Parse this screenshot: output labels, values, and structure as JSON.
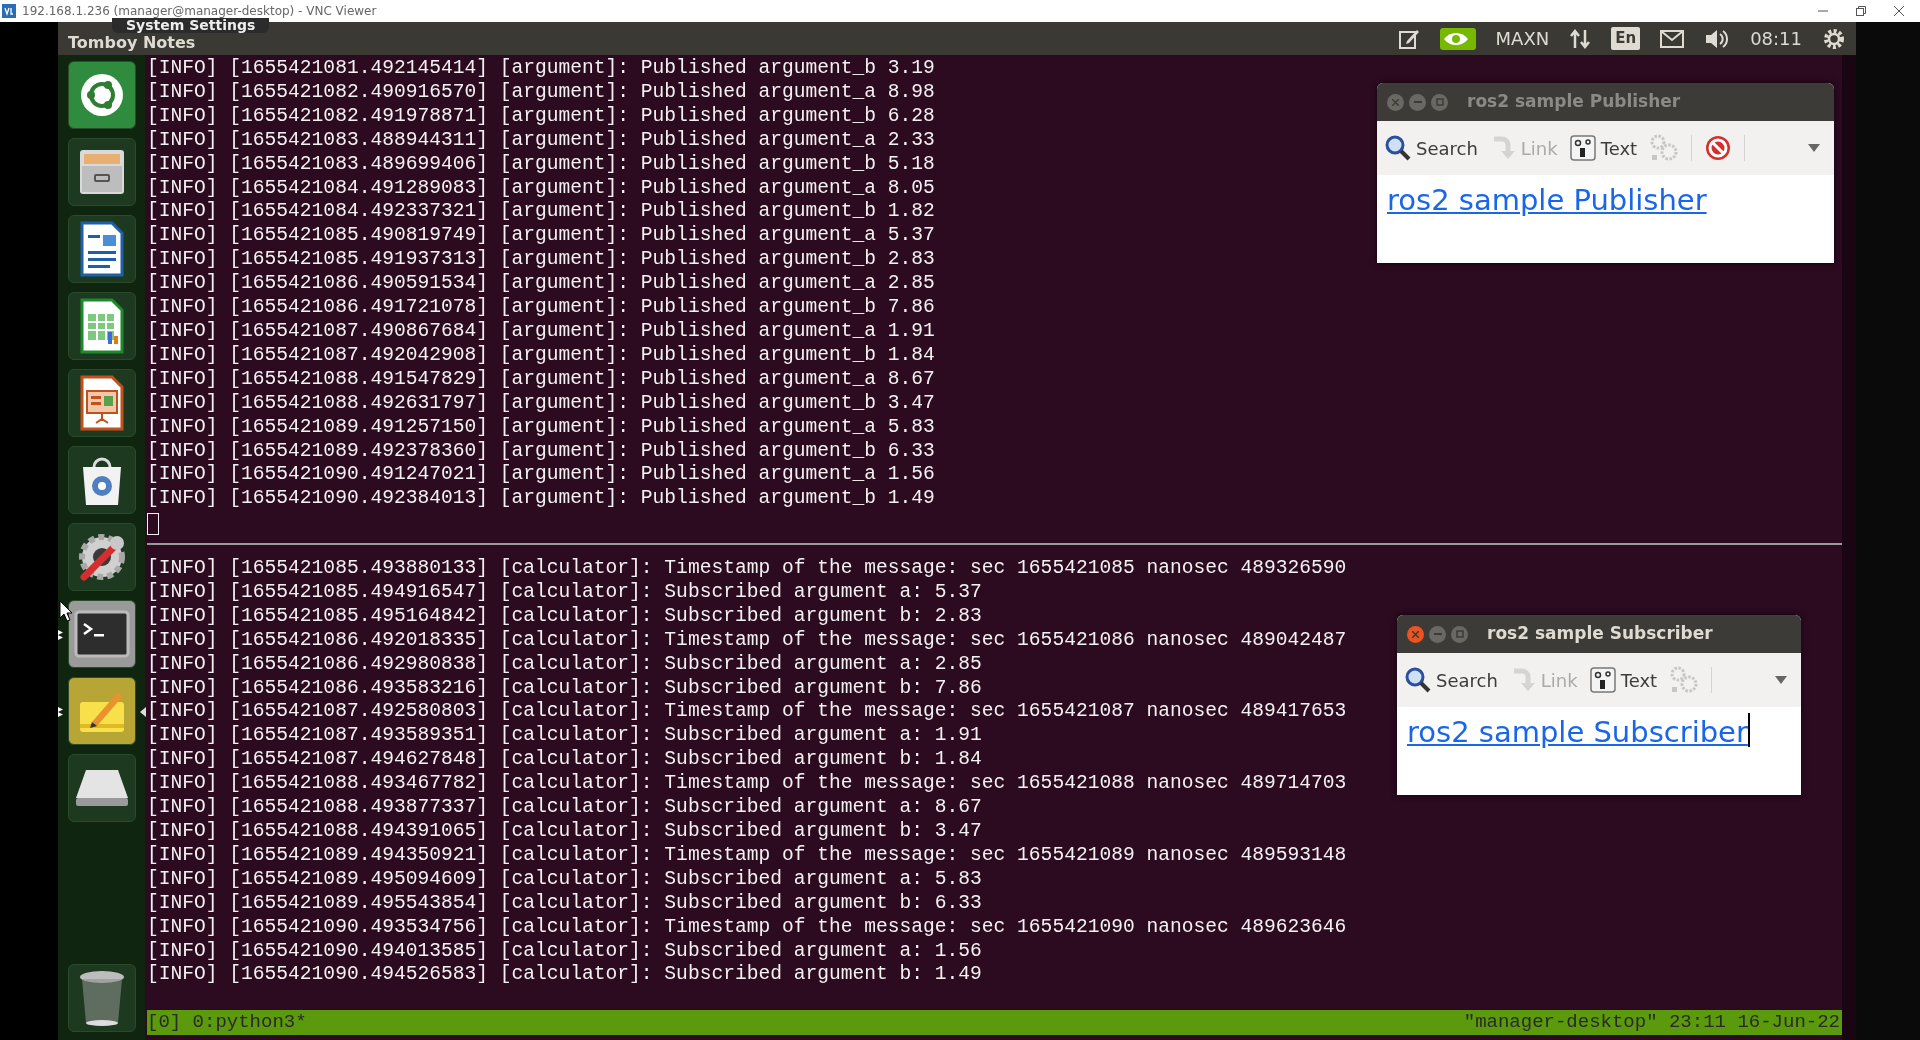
{
  "vnc_window": {
    "title": "192.168.1.236 (manager@manager-desktop) - VNC Viewer"
  },
  "top_panel": {
    "app_title": "Tomboy Notes",
    "tooltip": "System Settings",
    "indicators": [
      {
        "kind": "edit"
      },
      {
        "kind": "nvidia"
      },
      {
        "kind": "text",
        "label": "MAXN"
      },
      {
        "kind": "network"
      },
      {
        "kind": "keyboard",
        "label": "En"
      },
      {
        "kind": "mail"
      },
      {
        "kind": "volume"
      },
      {
        "kind": "text",
        "label": "08:11"
      },
      {
        "kind": "gear"
      }
    ]
  },
  "launcher": {
    "items": [
      {
        "kind": "dash",
        "running": false,
        "focused": false
      },
      {
        "kind": "files",
        "running": false,
        "focused": false
      },
      {
        "kind": "writer",
        "running": false,
        "focused": false
      },
      {
        "kind": "calc",
        "running": false,
        "focused": false
      },
      {
        "kind": "impress",
        "running": false,
        "focused": false
      },
      {
        "kind": "software",
        "running": false,
        "focused": false
      },
      {
        "kind": "settings",
        "running": false,
        "focused": false
      },
      {
        "kind": "terminal",
        "running": true,
        "focused": false
      },
      {
        "kind": "notes",
        "running": true,
        "focused": true
      },
      {
        "kind": "drive",
        "running": false,
        "focused": false
      }
    ],
    "trash": {
      "kind": "trash"
    }
  },
  "terminal": {
    "top_pane": {
      "lines": [
        "[INFO] [1655421081.492145414] [argument]: Published argument_b 3.19",
        "[INFO] [1655421082.490916570] [argument]: Published argument_a 8.98",
        "[INFO] [1655421082.491978871] [argument]: Published argument_b 6.28",
        "[INFO] [1655421083.488944311] [argument]: Published argument_a 2.33",
        "[INFO] [1655421083.489699406] [argument]: Published argument_b 5.18",
        "[INFO] [1655421084.491289083] [argument]: Published argument_a 8.05",
        "[INFO] [1655421084.492337321] [argument]: Published argument_b 1.82",
        "[INFO] [1655421085.490819749] [argument]: Published argument_a 5.37",
        "[INFO] [1655421085.491937313] [argument]: Published argument_b 2.83",
        "[INFO] [1655421086.490591534] [argument]: Published argument_a 2.85",
        "[INFO] [1655421086.491721078] [argument]: Published argument_b 7.86",
        "[INFO] [1655421087.490867684] [argument]: Published argument_a 1.91",
        "[INFO] [1655421087.492042908] [argument]: Published argument_b 1.84",
        "[INFO] [1655421088.491547829] [argument]: Published argument_a 8.67",
        "[INFO] [1655421088.492631797] [argument]: Published argument_b 3.47",
        "[INFO] [1655421089.491257150] [argument]: Published argument_a 5.83",
        "[INFO] [1655421089.492378360] [argument]: Published argument_b 6.33",
        "[INFO] [1655421090.491247021] [argument]: Published argument_a 1.56",
        "[INFO] [1655421090.492384013] [argument]: Published argument_b 1.49"
      ],
      "cursor": true
    },
    "bottom_pane": {
      "lines": [
        "[INFO] [1655421085.493880133] [calculator]: Timestamp of the message: sec 1655421085 nanosec 489326590",
        "[INFO] [1655421085.494916547] [calculator]: Subscribed argument a: 5.37",
        "[INFO] [1655421085.495164842] [calculator]: Subscribed argument b: 2.83",
        "[INFO] [1655421086.492018335] [calculator]: Timestamp of the message: sec 1655421086 nanosec 489042487",
        "[INFO] [1655421086.492980838] [calculator]: Subscribed argument a: 2.85",
        "[INFO] [1655421086.493583216] [calculator]: Subscribed argument b: 7.86",
        "[INFO] [1655421087.492580803] [calculator]: Timestamp of the message: sec 1655421087 nanosec 489417653",
        "[INFO] [1655421087.493589351] [calculator]: Subscribed argument a: 1.91",
        "[INFO] [1655421087.494627848] [calculator]: Subscribed argument b: 1.84",
        "[INFO] [1655421088.493467782] [calculator]: Timestamp of the message: sec 1655421088 nanosec 489714703",
        "[INFO] [1655421088.493877337] [calculator]: Subscribed argument a: 8.67",
        "[INFO] [1655421088.494391065] [calculator]: Subscribed argument b: 3.47",
        "[INFO] [1655421089.494350921] [calculator]: Timestamp of the message: sec 1655421089 nanosec 489593148",
        "[INFO] [1655421089.495094609] [calculator]: Subscribed argument a: 5.83",
        "[INFO] [1655421089.495543854] [calculator]: Subscribed argument b: 6.33",
        "[INFO] [1655421090.493534756] [calculator]: Timestamp of the message: sec 1655421090 nanosec 489623646",
        "[INFO] [1655421090.494013585] [calculator]: Subscribed argument a: 1.56",
        "[INFO] [1655421090.494526583] [calculator]: Subscribed argument b: 1.49"
      ]
    },
    "status_bar": {
      "left": "[0] 0:python3*",
      "right": "\"manager-desktop\" 23:11 16-Jun-22"
    }
  },
  "note_windows": [
    {
      "title": "ros2 sample Publisher",
      "active": false,
      "link": "ros2 sample Publisher",
      "cursor": false,
      "toolbar": [
        {
          "kind": "search",
          "label": "Search",
          "disabled": false
        },
        {
          "kind": "link",
          "label": "Link",
          "disabled": true
        },
        {
          "kind": "text",
          "label": "Text",
          "disabled": false
        },
        {
          "kind": "tools",
          "disabled": true
        },
        {
          "kind": "delete",
          "disabled": false
        },
        {
          "kind": "menu",
          "disabled": false
        }
      ]
    },
    {
      "title": "ros2 sample Subscriber",
      "active": true,
      "link": "ros2 sample Subscriber",
      "cursor": true,
      "toolbar": [
        {
          "kind": "search",
          "label": "Search",
          "disabled": false
        },
        {
          "kind": "link",
          "label": "Link",
          "disabled": true
        },
        {
          "kind": "text",
          "label": "Text",
          "disabled": false
        },
        {
          "kind": "tools",
          "disabled": true
        },
        {
          "kind": "menu",
          "disabled": false
        }
      ]
    }
  ]
}
